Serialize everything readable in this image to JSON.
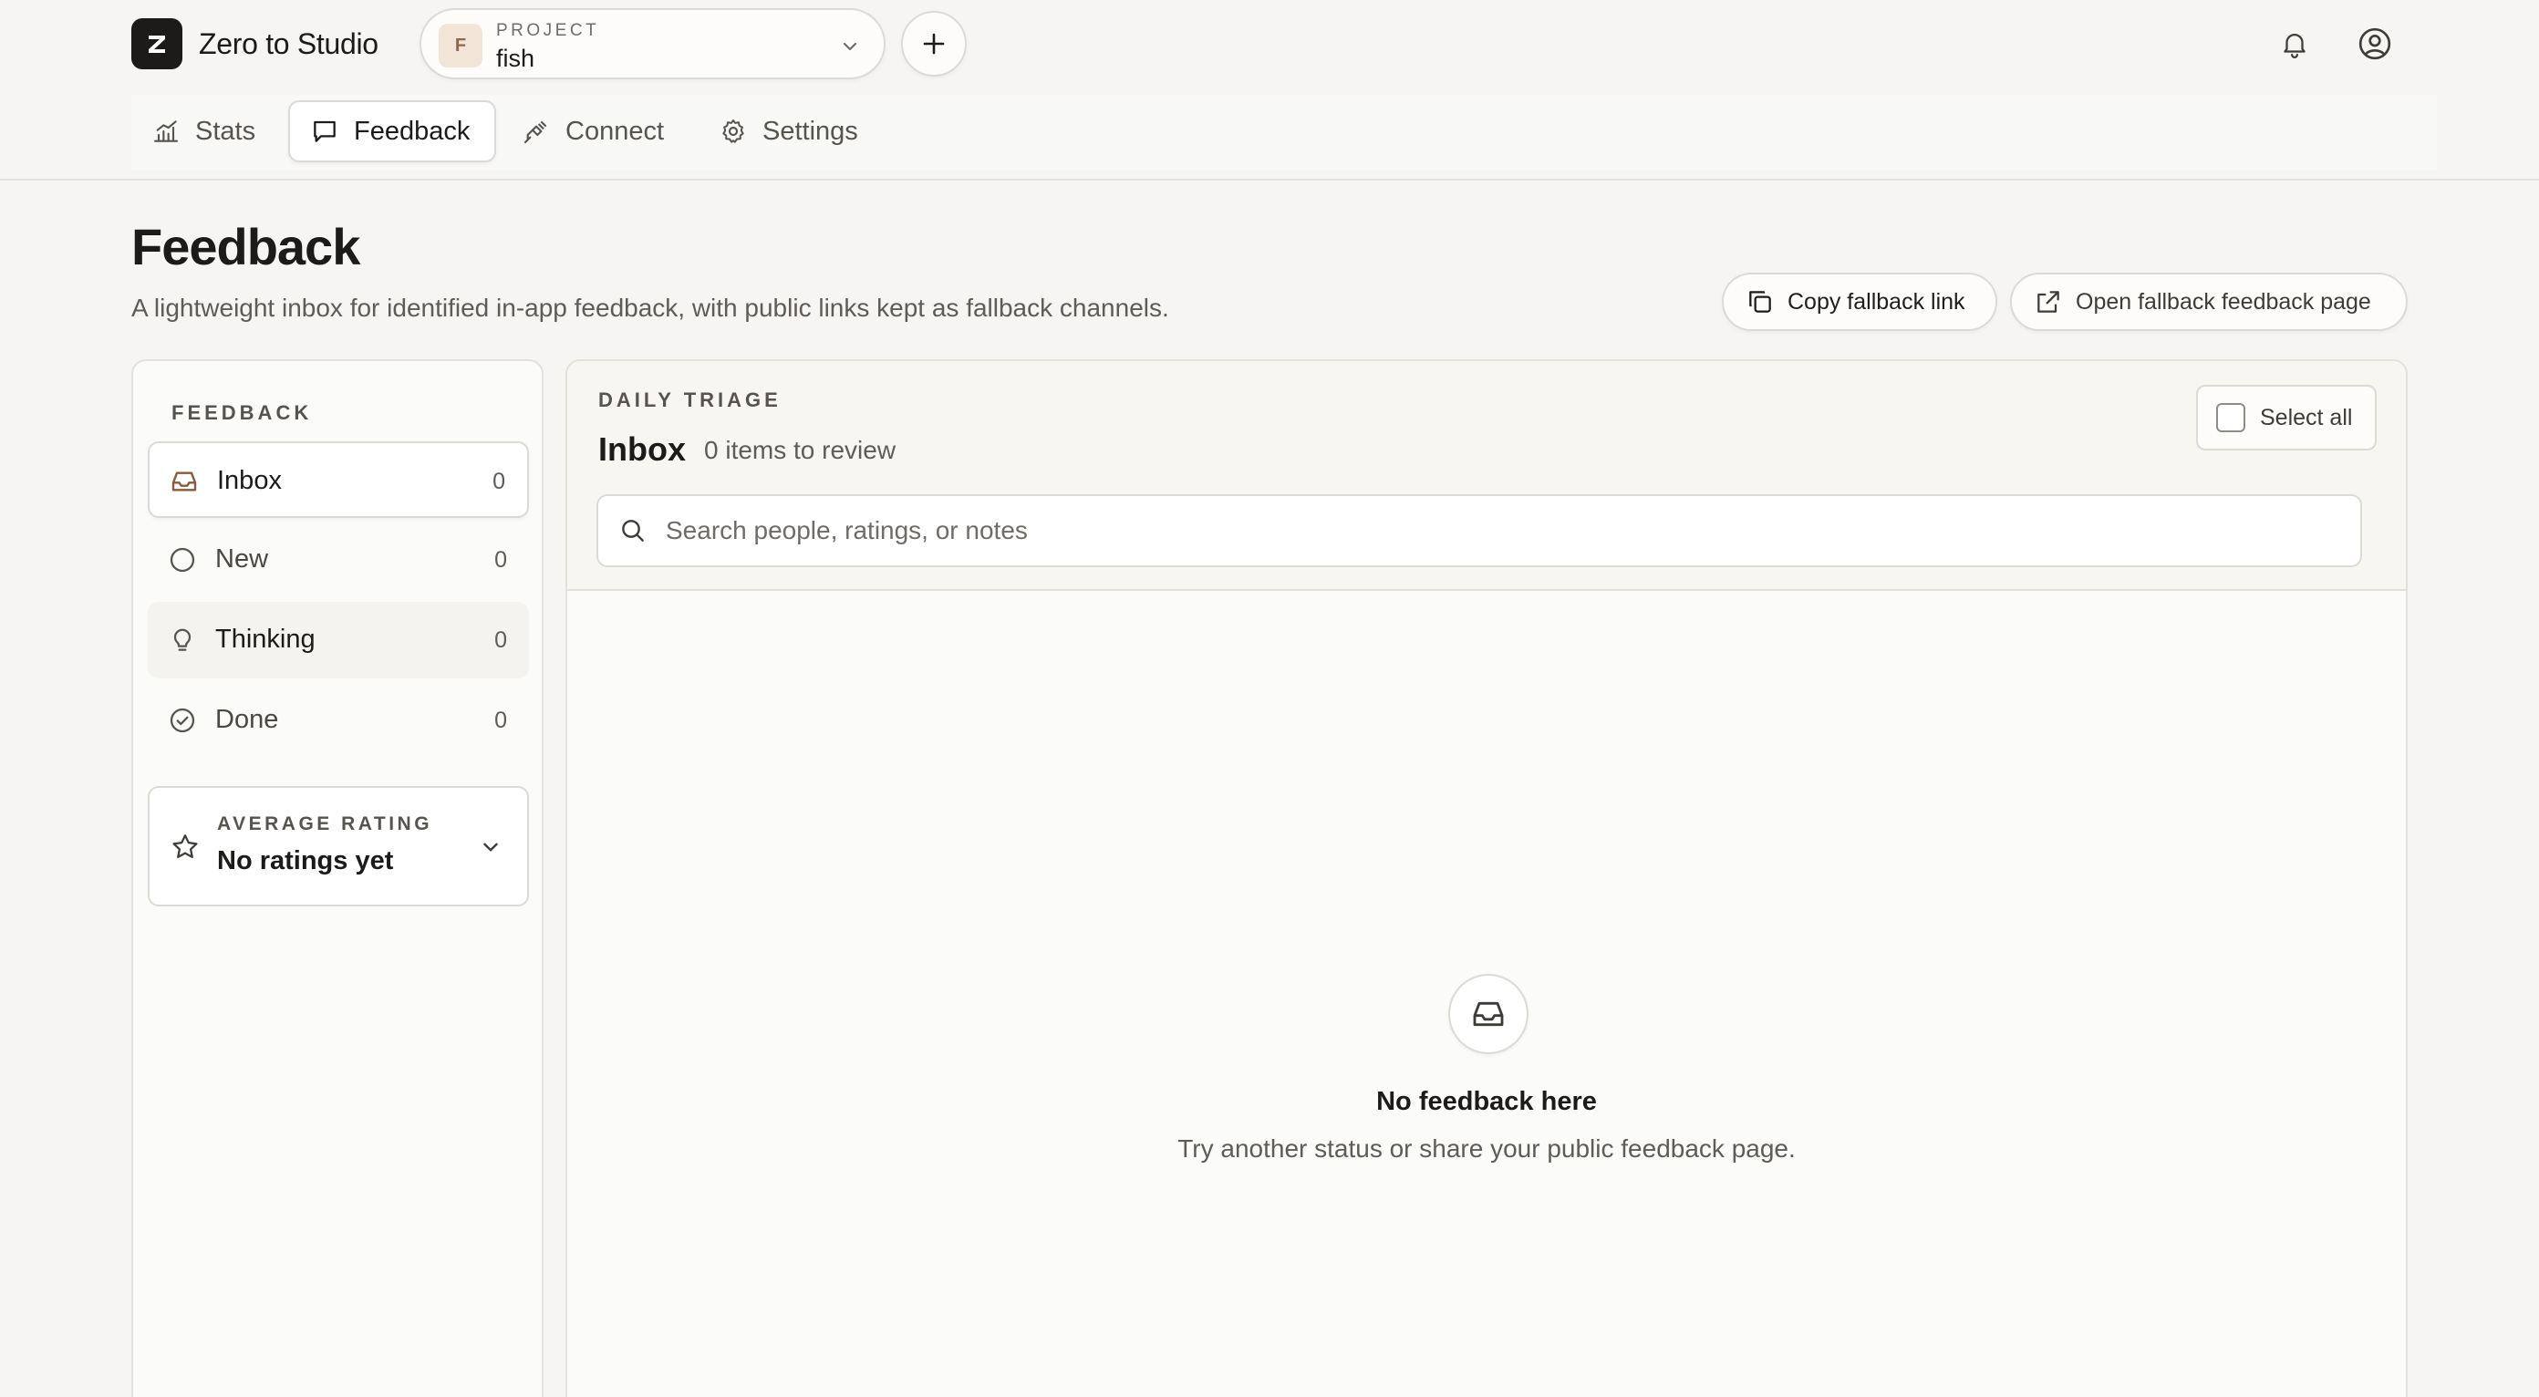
{
  "brand": {
    "name": "Zero to Studio",
    "logo_letter": "Z"
  },
  "project": {
    "label": "PROJECT",
    "value": "fish",
    "avatar": "F"
  },
  "nav": {
    "tabs": [
      {
        "label": "Stats",
        "icon": "chart-icon"
      },
      {
        "label": "Feedback",
        "icon": "message-icon",
        "active": true
      },
      {
        "label": "Connect",
        "icon": "plug-icon"
      },
      {
        "label": "Settings",
        "icon": "gear-icon"
      }
    ]
  },
  "page": {
    "title": "Feedback",
    "subtitle": "A lightweight inbox for identified in-app feedback, with public links kept as fallback channels.",
    "copy_link_label": "Copy fallback link",
    "open_page_label": "Open fallback feedback page"
  },
  "sidebar": {
    "section_label": "FEEDBACK",
    "items": [
      {
        "label": "Inbox",
        "count": "0",
        "icon": "inbox-icon",
        "active": true
      },
      {
        "label": "New",
        "count": "0",
        "icon": "circle-icon"
      },
      {
        "label": "Thinking",
        "count": "0",
        "icon": "lightbulb-icon"
      },
      {
        "label": "Done",
        "count": "0",
        "icon": "check-circle-icon"
      }
    ],
    "rating": {
      "label": "AVERAGE RATING",
      "value": "No ratings yet",
      "icon": "star-icon"
    }
  },
  "main": {
    "section_label": "DAILY TRIAGE",
    "title": "Inbox",
    "count_text": "0 items to review",
    "select_all_label": "Select all",
    "search_placeholder": "Search people, ratings, or notes",
    "empty": {
      "title": "No feedback here",
      "subtitle": "Try another status or share your public feedback page."
    }
  },
  "colors": {
    "background": "#f6f5f3",
    "panel": "#fbfbf9",
    "border": "#dcdad6",
    "text": "#1c1b1a",
    "accent_icon": "#8a5a3c"
  }
}
